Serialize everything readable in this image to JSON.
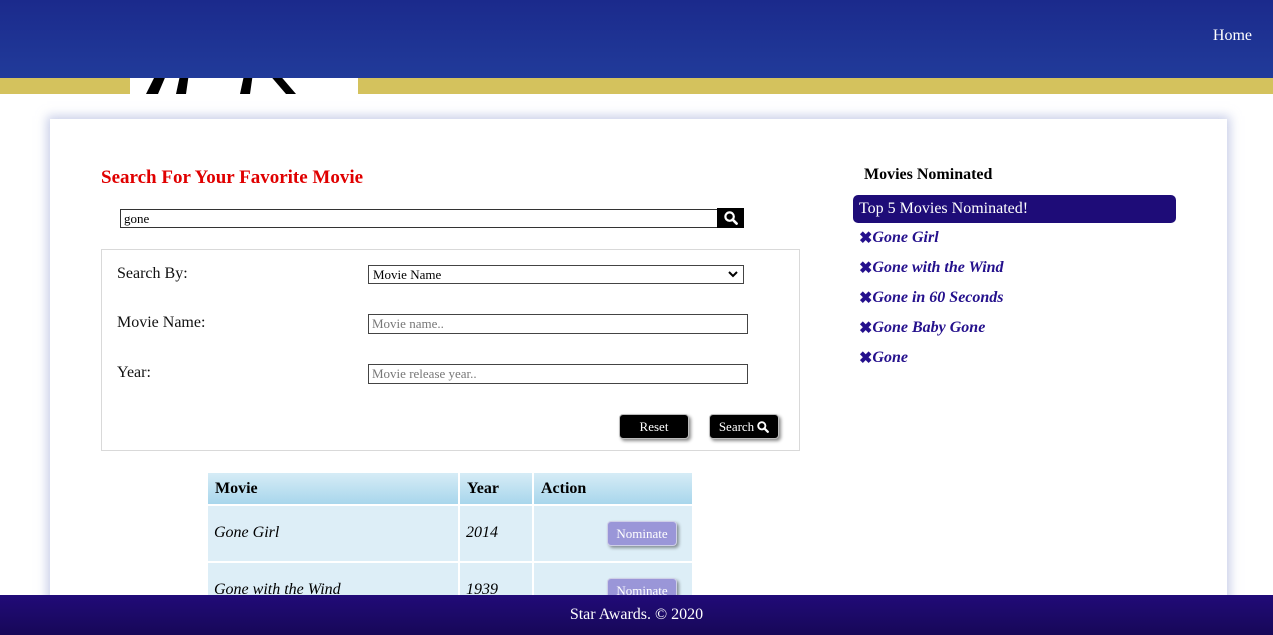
{
  "nav": {
    "home": "Home"
  },
  "search": {
    "title": "Search For Your Favorite Movie",
    "query_value": "gone",
    "search_by_label": "Search By:",
    "search_by_selected": "Movie Name",
    "movie_name_label": "Movie Name:",
    "movie_name_placeholder": "Movie name..",
    "year_label": "Year:",
    "year_placeholder": "Movie release year..",
    "reset_label": "Reset",
    "search_label": "Search"
  },
  "results": {
    "headers": [
      "Movie",
      "Year",
      "Action"
    ],
    "rows": [
      {
        "movie": "Gone Girl",
        "year": "2014",
        "action": "Nominate"
      },
      {
        "movie": "Gone with the Wind",
        "year": "1939",
        "action": "Nominate"
      }
    ]
  },
  "nominations": {
    "title": "Movies Nominated",
    "banner": "Top 5 Movies Nominated!",
    "remove_icon": "✖",
    "items": [
      "Gone Girl",
      "Gone with the Wind",
      "Gone in 60 Seconds",
      "Gone Baby Gone",
      "Gone"
    ]
  },
  "footer": {
    "text": "Star Awards. © 2020"
  },
  "colors": {
    "navbar": "#1b2a8c",
    "gold_band": "#d4c25d",
    "title_red": "#e00000",
    "nominee_purple": "#24108c",
    "footer": "#1a0964",
    "nominate_button": "#9a96d8"
  }
}
